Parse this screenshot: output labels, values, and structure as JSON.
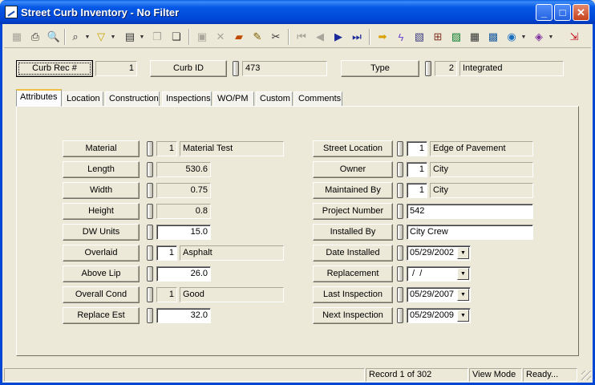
{
  "window": {
    "title": "Street Curb Inventory - No Filter",
    "controls": {
      "minimize": "_",
      "maximize": "□",
      "close": "✕"
    }
  },
  "toolbar": {
    "icons": [
      "first-record-disabled-icon",
      "print-icon",
      "print-preview-icon",
      "binoculars-icon",
      "filter-icon",
      "form-view-icon",
      "copy-disabled-icon",
      "copy-icon",
      "save-disabled-icon",
      "delete-disabled-icon",
      "edit-cards-icon",
      "pencil-icon",
      "scissors-icon",
      "nav-first-disabled-icon",
      "nav-prev-disabled-icon",
      "nav-next-icon",
      "nav-last-icon",
      "arrow-right-icon",
      "lightning-icon",
      "map-icon",
      "tree-icon",
      "picture-icon",
      "calculator-icon",
      "map-grid-icon",
      "globe-icon",
      "book-icon",
      "exit-icon"
    ]
  },
  "header": {
    "curb_rec": {
      "label": "Curb Rec #",
      "value": "1"
    },
    "curb_id": {
      "label": "Curb ID",
      "value": "473"
    },
    "type": {
      "label": "Type",
      "code": "2",
      "value": "Integrated"
    }
  },
  "tabs": [
    "Attributes",
    "Location",
    "Construction",
    "Inspections",
    "WO/PM",
    "Custom",
    "Comments"
  ],
  "active_tab": "Attributes",
  "left_fields": [
    {
      "label": "Material",
      "code": "1",
      "value": "Material Test"
    },
    {
      "label": "Length",
      "value": "530.6"
    },
    {
      "label": "Width",
      "value": "0.75"
    },
    {
      "label": "Height",
      "value": "0.8"
    },
    {
      "label": "DW Units",
      "value": "15.0"
    },
    {
      "label": "Overlaid",
      "code": "1",
      "value": "Asphalt"
    },
    {
      "label": "Above Lip",
      "value": "26.0"
    },
    {
      "label": "Overall Cond",
      "code": "1",
      "value": "Good"
    },
    {
      "label": "Replace Est",
      "value": "32.0"
    }
  ],
  "right_fields": [
    {
      "label": "Street Location",
      "code": "1",
      "value": "Edge of Pavement"
    },
    {
      "label": "Owner",
      "code": "1",
      "value": "City"
    },
    {
      "label": "Maintained By",
      "code": "1",
      "value": "City"
    },
    {
      "label": "Project Number",
      "value": "542"
    },
    {
      "label": "Installed By",
      "value": "City Crew"
    },
    {
      "label": "Date Installed",
      "value": "05/29/2002"
    },
    {
      "label": "Replacement",
      "value": " /  /"
    },
    {
      "label": "Last Inspection",
      "value": "05/29/2007"
    },
    {
      "label": "Next Inspection",
      "value": "05/29/2009"
    }
  ],
  "status": {
    "record": "Record 1 of 302",
    "mode": "View Mode",
    "state": "Ready..."
  },
  "colors": {
    "title_bar": "#0047d6",
    "face": "#ece9d8",
    "tab_highlight": "#f0c048"
  }
}
